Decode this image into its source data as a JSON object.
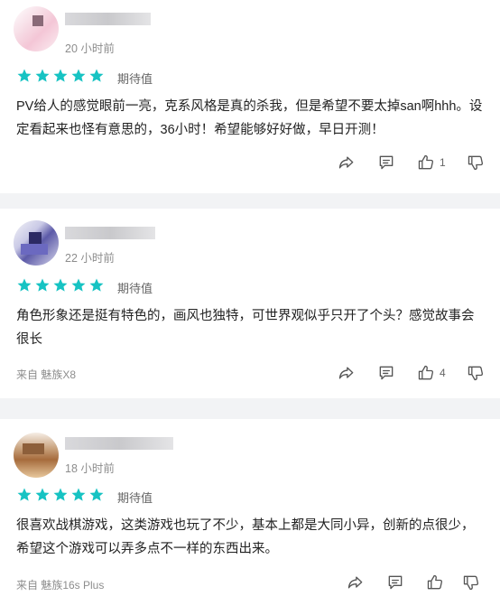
{
  "colors": {
    "star": "#17c3c3",
    "background": "#f2f3f5"
  },
  "reviews": [
    {
      "time": "20 小时前",
      "rating_label": "期待值",
      "stars": 5,
      "content": "PV给人的感觉眼前一亮，克系风格是真的杀我，但是希望不要太掉san啊hhh。设定看起来也怪有意思的，36小时！希望能够好好做，早日开测！",
      "device": "",
      "likes": "1"
    },
    {
      "time": "22 小时前",
      "rating_label": "期待值",
      "stars": 5,
      "content": "角色形象还是挺有特色的，画风也独特，可世界观似乎只开了个头？感觉故事会很长",
      "device": "来自 魅族X8",
      "likes": "4"
    },
    {
      "time": "18 小时前",
      "rating_label": "期待值",
      "stars": 5,
      "content": "很喜欢战棋游戏，这类游戏也玩了不少，基本上都是大同小异，创新的点很少，希望这个游戏可以弄多点不一样的东西出来。",
      "device": "来自 魅族16s Plus",
      "likes": ""
    }
  ],
  "icons": [
    "share-icon",
    "comment-icon",
    "thumbs-up-icon",
    "thumbs-down-icon",
    "star-icon"
  ]
}
